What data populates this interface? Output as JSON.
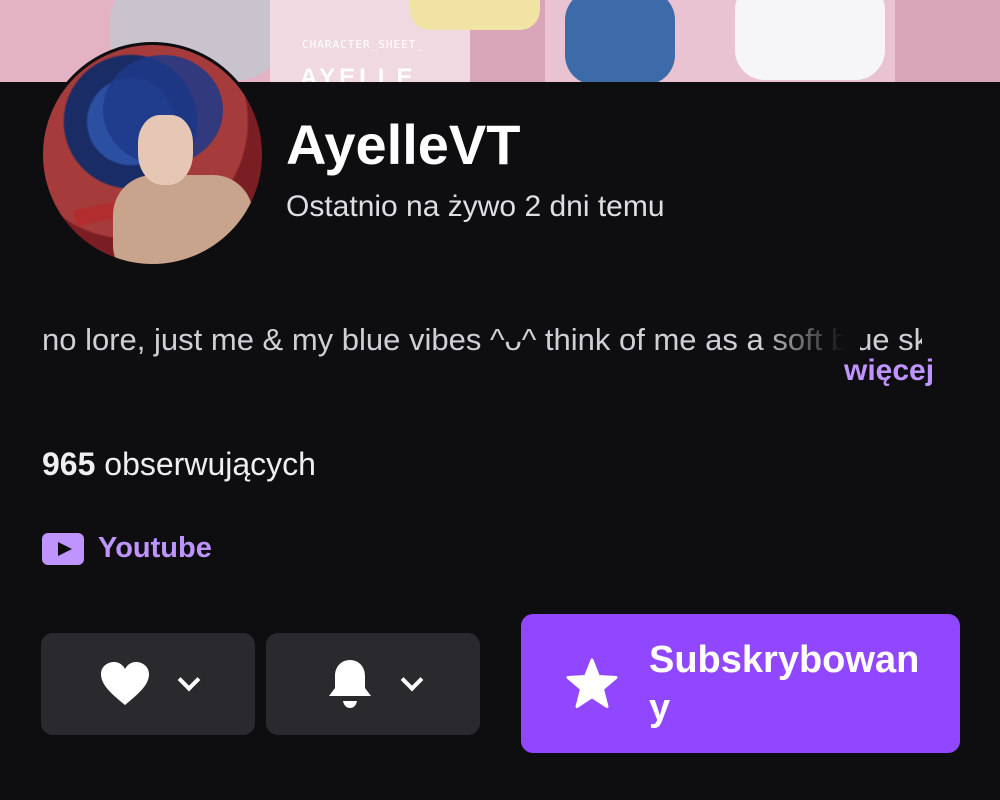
{
  "banner": {
    "sheet_label": "CHARACTER_SHEET_",
    "sheet_title": "AYELLE"
  },
  "channel": {
    "name": "AyelleVT",
    "last_live": "Ostatnio na żywo 2 dni temu",
    "bio": "no lore, just me & my blue vibes ^ᴗ^ think of me as a soft blue sky or a soothing blue wave, here to",
    "more_label": "więcej",
    "followers_count": "965",
    "followers_label": "obserwujących"
  },
  "social": {
    "icon": "youtube-icon",
    "label": "Youtube"
  },
  "actions": {
    "follow_icon": "heart-icon",
    "notify_icon": "bell-icon",
    "subscribe_icon": "star-icon",
    "subscribe_label": "Subskrybowany"
  },
  "colors": {
    "accent": "#9147ff",
    "accent_text": "#bf94ff",
    "background": "#0e0e10",
    "button_bg": "#2a2a2e"
  }
}
